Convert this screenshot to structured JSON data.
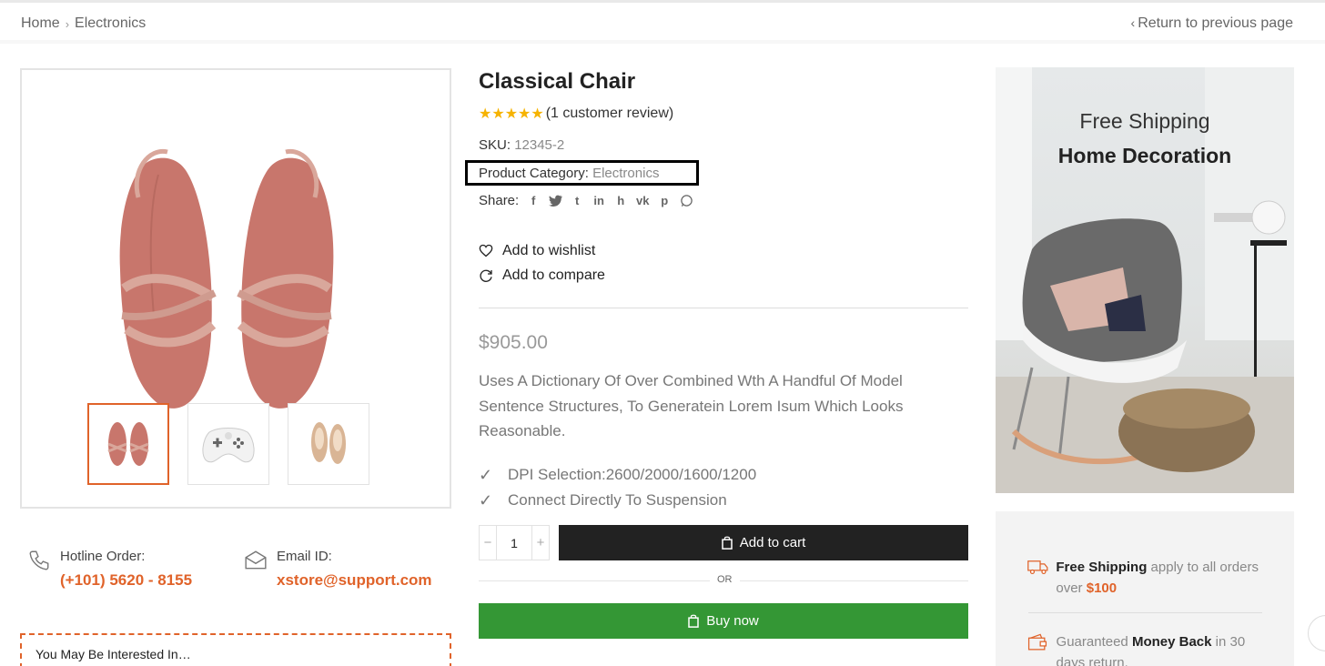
{
  "breadcrumb": {
    "home": "Home",
    "separator": "›",
    "current": "Electronics"
  },
  "back_link": {
    "label": "Return to previous page"
  },
  "product": {
    "title": "Classical Chair",
    "rating_stars": "★★★★★",
    "review_text": "(1 customer review)",
    "sku_label": "SKU:",
    "sku_value": "12345-2",
    "category_label": "Product Category:",
    "category_value": "Electronics",
    "share_label": "Share:",
    "wishlist_label": "Add to wishlist",
    "compare_label": "Add to compare",
    "price": "$905.00",
    "description": "Uses A Dictionary Of Over Combined Wth A Handful Of Model Sentence Structures, To Generatein Lorem Isum Which Looks Reasonable.",
    "features": [
      "DPI Selection:2600/2000/1600/1200",
      "Connect Directly To Suspension"
    ],
    "quantity": "1",
    "add_to_cart": "Add to cart",
    "or": "OR",
    "buy_now": "Buy now"
  },
  "share_icons": [
    "facebook-icon",
    "twitter-icon",
    "tumblr-icon",
    "linkedin-icon",
    "houzz-icon",
    "vk-icon",
    "pinterest-icon",
    "whatsapp-icon"
  ],
  "contact": {
    "hotline_label": "Hotline Order:",
    "hotline_value": "(+101) 5620 - 8155",
    "email_label": "Email ID:",
    "email_value": "xstore@support.com"
  },
  "interested": {
    "label": "You May Be Interested In…"
  },
  "banner": {
    "subtitle": "Free Shipping",
    "title": "Home Decoration"
  },
  "perks": {
    "shipping": {
      "bold": "Free Shipping",
      "text": " apply to all orders over ",
      "amount": "$100"
    },
    "money": {
      "text1": "Guaranteed ",
      "bold": "Money Back",
      "text2": " in 30 days return."
    }
  },
  "colors": {
    "accent": "#e0632a",
    "buy": "#349735",
    "cart": "#222222",
    "stars": "#f6b300"
  }
}
